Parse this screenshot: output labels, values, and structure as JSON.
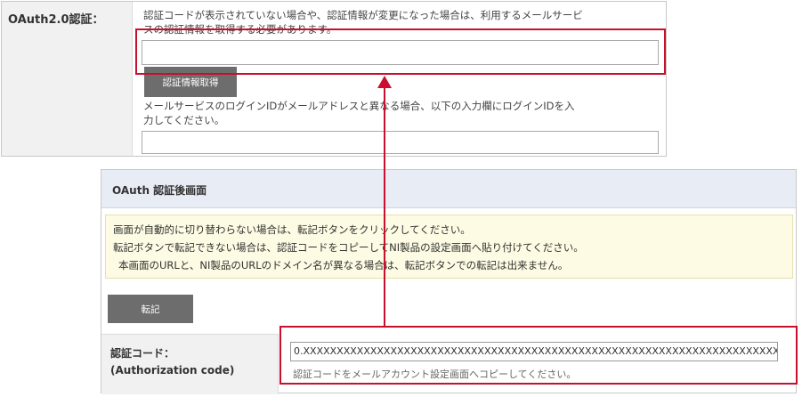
{
  "top_panel": {
    "label": "OAuth2.0認証：",
    "note_line1": "認証コードが表示されていない場合や、認証情報が変更になった場合は、利用するメールサービ",
    "note_line2": "スの認証情報を取得する必要があります。",
    "get_button": "認証情報取得",
    "login_note_line1": "メールサービスのログインIDがメールアドレスと異なる場合、以下の入力欄にログインIDを入",
    "login_note_line2": "力してください。"
  },
  "oauth_screen": {
    "title": "OAuth 認証後画面",
    "notice_lines": [
      "画面が自動的に切り替わらない場合は、転記ボタンをクリックしてください。",
      "転記ボタンで転記できない場合は、認証コードをコピーしてNI製品の設定画面へ貼り付けてください。",
      "本画面のURLと、NI製品のURLのドメイン名が異なる場合は、転記ボタンでの転記は出来ません。"
    ],
    "transfer_button": "転記",
    "code_label_line1": "認証コード：",
    "code_label_line2": "(Authorization code)",
    "code_value": "0.XXXXXXXXXXXXXXXXXXXXXXXXXXXXXXXXXXXXXXXXXXXXXXXXXXXXXXXXXXXXXXXXXXXXXXX",
    "code_help": "認証コードをメールアカウント設定画面へコピーしてください。"
  },
  "colors": {
    "highlight": "#c8102e",
    "button": "#6d6d6d",
    "notice_bg": "#fdfbe3",
    "header_bg": "#e8ecf5"
  }
}
